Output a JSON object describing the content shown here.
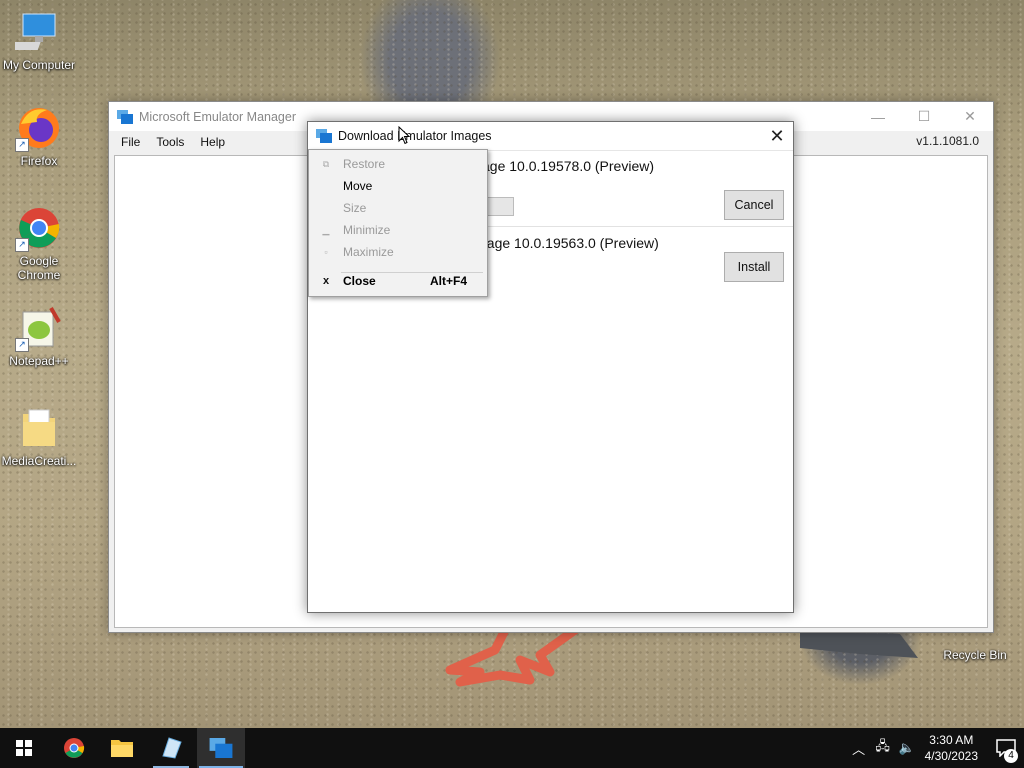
{
  "desktop": {
    "icons": [
      {
        "label": "My Computer"
      },
      {
        "label": "Firefox"
      },
      {
        "label": "Google Chrome"
      },
      {
        "label": "Notepad++"
      },
      {
        "label": "MediaCreati..."
      },
      {
        "label": "Recycle Bin"
      }
    ]
  },
  "main_window": {
    "title": "Microsoft Emulator Manager",
    "menu": [
      "File",
      "Tools",
      "Help"
    ],
    "version": "v1.1.1081.0",
    "controls": {
      "minimize": "—",
      "maximize": "☐",
      "close": "✕"
    }
  },
  "dialog": {
    "title": "Download Emulator Images",
    "close": "✕",
    "images": [
      {
        "name": "Windows 10X Emulator Image 10.0.19578.0 (Preview)",
        "visible_name": "age 10.0.19578.0 (Preview)",
        "button": "Cancel"
      },
      {
        "name": "Windows 10X Emulator Image 10.0.19563.0 (Preview)",
        "visible_name": "nage 10.0.19563.0 (Preview)",
        "button": "Install"
      }
    ]
  },
  "system_menu": {
    "items": [
      {
        "label": "Restore",
        "enabled": false,
        "icon": "restore-icon"
      },
      {
        "label": "Move",
        "enabled": true,
        "icon": ""
      },
      {
        "label": "Size",
        "enabled": false,
        "icon": ""
      },
      {
        "label": "Minimize",
        "enabled": false,
        "icon": "minimize-icon"
      },
      {
        "label": "Maximize",
        "enabled": false,
        "icon": "maximize-icon"
      },
      {
        "label": "Close",
        "enabled": true,
        "icon": "close-icon",
        "shortcut": "Alt+F4"
      }
    ]
  },
  "taskbar": {
    "apps": [
      "start",
      "chrome",
      "file-explorer",
      "emulator-tool",
      "emulator-manager"
    ],
    "tray": {
      "time": "3:30 AM",
      "date": "4/30/2023",
      "notifications": "4"
    }
  },
  "colors": {
    "taskbar": "#101010",
    "accent": "#0078d7"
  }
}
